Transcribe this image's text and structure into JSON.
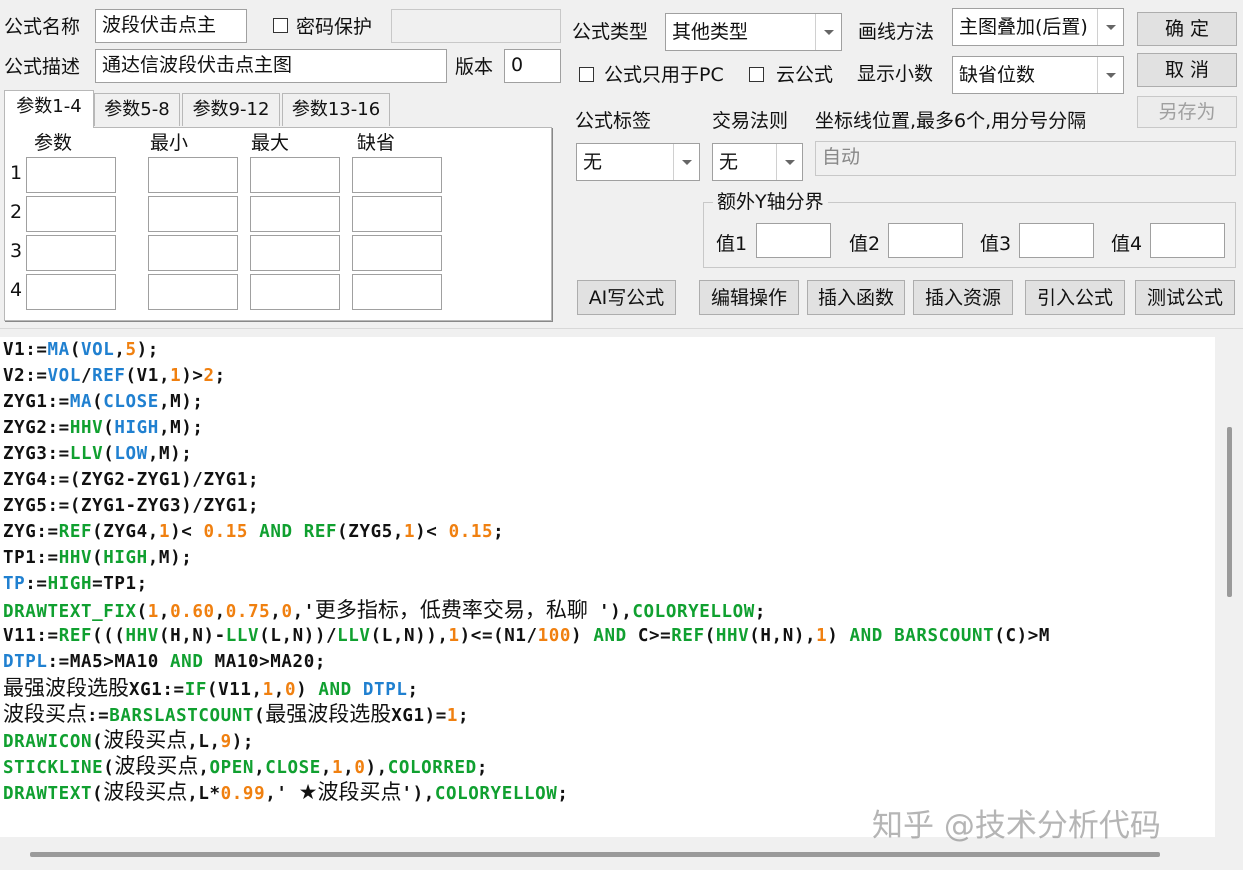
{
  "header": {
    "name_label": "公式名称",
    "name_value": "波段伏击点主",
    "password_label": "密码保护",
    "desc_label": "公式描述",
    "desc_value": "通达信波段伏击点主图",
    "version_label": "版本",
    "version_value": "0",
    "type_label": "公式类型",
    "type_value": "其他类型",
    "draw_label": "画线方法",
    "draw_value": "主图叠加(后置)",
    "pc_only_label": "公式只用于PC",
    "cloud_label": "云公式",
    "decimal_label": "显示小数",
    "decimal_value": "缺省位数",
    "ok_label": "确 定",
    "cancel_label": "取 消",
    "saveas_label": "另存为"
  },
  "params": {
    "tabs": [
      "参数1-4",
      "参数5-8",
      "参数9-12",
      "参数13-16"
    ],
    "columns": [
      "参数",
      "最小",
      "最大",
      "缺省"
    ],
    "rows": [
      "1",
      "2",
      "3",
      "4"
    ]
  },
  "options": {
    "tag_label": "公式标签",
    "tag_value": "无",
    "rule_label": "交易法则",
    "rule_value": "无",
    "coord_label": "坐标线位置,最多6个,用分号分隔",
    "coord_placeholder": "自动",
    "yaxis_group": "额外Y轴分界",
    "y_labels": [
      "值1",
      "值2",
      "值3",
      "值4"
    ]
  },
  "toolbar": {
    "ai_label": "AI写公式",
    "edit_label": "编辑操作",
    "insert_func_label": "插入函数",
    "insert_res_label": "插入资源",
    "import_label": "引入公式",
    "test_label": "测试公式"
  },
  "code": [
    [
      [
        "V1:=",
        ""
      ],
      [
        "MA",
        "b"
      ],
      [
        "(",
        ""
      ],
      [
        "VOL",
        "b"
      ],
      [
        ",",
        ""
      ],
      [
        "5",
        "n"
      ],
      [
        ");",
        ""
      ]
    ],
    [
      [
        "V2:=",
        ""
      ],
      [
        "VOL",
        "b"
      ],
      [
        "/",
        ""
      ],
      [
        "REF",
        "b"
      ],
      [
        "(V1,",
        ""
      ],
      [
        "1",
        "n"
      ],
      [
        ")>",
        ""
      ],
      [
        "2",
        "n"
      ],
      [
        ";",
        ""
      ]
    ],
    [
      [
        "ZYG1:=",
        ""
      ],
      [
        "MA",
        "b"
      ],
      [
        "(",
        ""
      ],
      [
        "CLOSE",
        "b"
      ],
      [
        ",M);",
        ""
      ]
    ],
    [
      [
        "ZYG2:=",
        ""
      ],
      [
        "HHV",
        "g"
      ],
      [
        "(",
        ""
      ],
      [
        "HIGH",
        "b"
      ],
      [
        ",M);",
        ""
      ]
    ],
    [
      [
        "ZYG3:=",
        ""
      ],
      [
        "LLV",
        "g"
      ],
      [
        "(",
        ""
      ],
      [
        "LOW",
        "b"
      ],
      [
        ",M);",
        ""
      ]
    ],
    [
      [
        "ZYG4:=(ZYG2-ZYG1)/ZYG1;",
        ""
      ]
    ],
    [
      [
        "ZYG5:=(ZYG1-ZYG3)/ZYG1;",
        ""
      ]
    ],
    [
      [
        "ZYG:=",
        ""
      ],
      [
        "REF",
        "g"
      ],
      [
        "(ZYG4,",
        ""
      ],
      [
        "1",
        "n"
      ],
      [
        ")< ",
        ""
      ],
      [
        "0.15",
        "n"
      ],
      [
        " ",
        ""
      ],
      [
        "AND",
        "g"
      ],
      [
        " ",
        ""
      ],
      [
        "REF",
        "g"
      ],
      [
        "(ZYG5,",
        ""
      ],
      [
        "1",
        "n"
      ],
      [
        ")< ",
        ""
      ],
      [
        "0.15",
        "n"
      ],
      [
        ";",
        ""
      ]
    ],
    [
      [
        "TP1:=",
        ""
      ],
      [
        "HHV",
        "g"
      ],
      [
        "(",
        ""
      ],
      [
        "HIGH",
        "g"
      ],
      [
        ",M);",
        ""
      ]
    ],
    [
      [
        "TP",
        "b"
      ],
      [
        ":=",
        ""
      ],
      [
        "HIGH",
        "g"
      ],
      [
        "=TP1;",
        ""
      ]
    ],
    [
      [
        "DRAWTEXT_FIX",
        "g"
      ],
      [
        "(",
        ""
      ],
      [
        "1",
        "n"
      ],
      [
        ",",
        ""
      ],
      [
        "0.60",
        "n"
      ],
      [
        ",",
        ""
      ],
      [
        "0.75",
        "n"
      ],
      [
        ",",
        ""
      ],
      [
        "0",
        "n"
      ],
      [
        ",'",
        ""
      ],
      [
        "更多指标，低费率交易，私聊",
        "cn"
      ],
      [
        " '),",
        ""
      ],
      [
        "COLORYELLOW",
        "g"
      ],
      [
        ";",
        ""
      ]
    ],
    [
      [
        "V11:=",
        ""
      ],
      [
        "REF",
        "g"
      ],
      [
        "(((",
        ""
      ],
      [
        "HHV",
        "g"
      ],
      [
        "(H,N)-",
        ""
      ],
      [
        "LLV",
        "g"
      ],
      [
        "(L,N))/",
        ""
      ],
      [
        "LLV",
        "g"
      ],
      [
        "(L,N)),",
        ""
      ],
      [
        "1",
        "n"
      ],
      [
        ")<=(N1/",
        ""
      ],
      [
        "100",
        "n"
      ],
      [
        ") ",
        ""
      ],
      [
        "AND",
        "g"
      ],
      [
        " C>=",
        ""
      ],
      [
        "REF",
        "g"
      ],
      [
        "(",
        ""
      ],
      [
        "HHV",
        "g"
      ],
      [
        "(H,N),",
        ""
      ],
      [
        "1",
        "n"
      ],
      [
        ") ",
        ""
      ],
      [
        "AND",
        "g"
      ],
      [
        " ",
        ""
      ],
      [
        "BARSCOUNT",
        "g"
      ],
      [
        "(C)>M",
        ""
      ]
    ],
    [
      [
        "DTPL",
        "b"
      ],
      [
        ":=MA5>MA10 ",
        ""
      ],
      [
        "AND",
        "g"
      ],
      [
        " MA10>MA20;",
        ""
      ]
    ],
    [
      [
        "最强波段选股",
        "cn"
      ],
      [
        "XG1:=",
        ""
      ],
      [
        "IF",
        "g"
      ],
      [
        "(V11,",
        ""
      ],
      [
        "1",
        "n"
      ],
      [
        ",",
        ""
      ],
      [
        "0",
        "n"
      ],
      [
        ") ",
        ""
      ],
      [
        "AND",
        "g"
      ],
      [
        " ",
        ""
      ],
      [
        "DTPL",
        "b"
      ],
      [
        ";",
        ""
      ]
    ],
    [
      [
        "波段买点",
        "cn"
      ],
      [
        ":=",
        ""
      ],
      [
        "BARSLASTCOUNT",
        "g"
      ],
      [
        "(",
        ""
      ],
      [
        "最强波段选股",
        "cn"
      ],
      [
        "XG1)=",
        ""
      ],
      [
        "1",
        "n"
      ],
      [
        ";",
        ""
      ]
    ],
    [
      [
        "DRAWICON",
        "g"
      ],
      [
        "(",
        ""
      ],
      [
        "波段买点",
        "cn"
      ],
      [
        ",L,",
        ""
      ],
      [
        "9",
        "n"
      ],
      [
        ");",
        ""
      ]
    ],
    [
      [
        "STICKLINE",
        "g"
      ],
      [
        "(",
        ""
      ],
      [
        "波段买点",
        "cn"
      ],
      [
        ",",
        ""
      ],
      [
        "OPEN",
        "g"
      ],
      [
        ",",
        ""
      ],
      [
        "CLOSE",
        "g"
      ],
      [
        ",",
        ""
      ],
      [
        "1",
        "n"
      ],
      [
        ",",
        ""
      ],
      [
        "0",
        "n"
      ],
      [
        "),",
        ""
      ],
      [
        "COLORRED",
        "g"
      ],
      [
        ";",
        ""
      ]
    ],
    [
      [
        "DRAWTEXT",
        "g"
      ],
      [
        "(",
        ""
      ],
      [
        "波段买点",
        "cn"
      ],
      [
        ",L*",
        ""
      ],
      [
        "0.99",
        "n"
      ],
      [
        ",' ",
        ""
      ],
      [
        "★波段买点",
        "cn"
      ],
      [
        "'),",
        ""
      ],
      [
        "COLORYELLOW",
        "g"
      ],
      [
        ";",
        ""
      ]
    ]
  ],
  "watermark": "知乎 @技术分析代码"
}
